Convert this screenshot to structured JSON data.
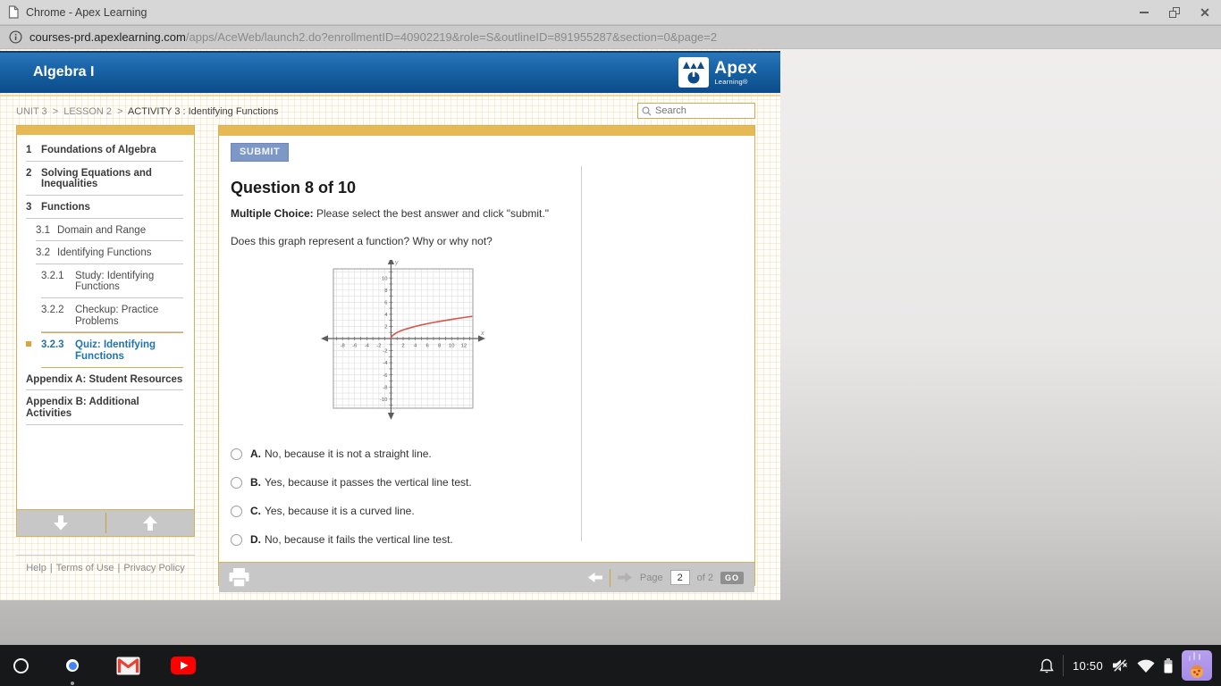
{
  "window": {
    "title": "Chrome - Apex Learning",
    "url_domain": "courses-prd.apexlearning.com",
    "url_path": "/apps/AceWeb/launch2.do?enrollmentID=40902219&role=S&outlineID=891955287&section=0&page=2"
  },
  "header": {
    "course_title": "Algebra I",
    "brand_name": "Apex",
    "brand_sub": "Learning®"
  },
  "breadcrumb": {
    "unit": "UNIT 3",
    "lesson": "LESSON 2",
    "activity": "ACTIVITY 3 : Identifying Functions",
    "separator": ">"
  },
  "search": {
    "placeholder": "Search"
  },
  "sidebar": {
    "items": [
      {
        "num": "1",
        "label": "Foundations of Algebra",
        "level": 1
      },
      {
        "num": "2",
        "label": "Solving Equations and Inequalities",
        "level": 1
      },
      {
        "num": "3",
        "label": "Functions",
        "level": 1
      },
      {
        "num": "3.1",
        "label": "Domain and Range",
        "level": 2
      },
      {
        "num": "3.2",
        "label": "Identifying Functions",
        "level": 2
      },
      {
        "num": "3.2.1",
        "label": "Study: Identifying Functions",
        "level": 3
      },
      {
        "num": "3.2.2",
        "label": "Checkup: Practice Problems",
        "level": 3
      },
      {
        "num": "3.2.3",
        "label": "Quiz: Identifying Functions",
        "level": 3,
        "active": true
      },
      {
        "num": "",
        "label": "Appendix A: Student Resources",
        "level": 1
      },
      {
        "num": "",
        "label": "Appendix B: Additional Activities",
        "level": 1
      }
    ]
  },
  "footer_links": {
    "links": [
      "Help",
      "Terms of Use",
      "Privacy Policy"
    ],
    "separator": "|"
  },
  "question": {
    "submit_label": "SUBMIT",
    "title": "Question 8 of 10",
    "type_label": "Multiple Choice:",
    "instructions": " Please select the best answer and click \"submit.\"",
    "prompt": "Does this graph represent a function? Why or why not?",
    "options": [
      {
        "letter": "A",
        "text": "No, because it is not a straight line."
      },
      {
        "letter": "B",
        "text": "Yes, because it passes the vertical line test."
      },
      {
        "letter": "C",
        "text": "Yes, because it is a curved line."
      },
      {
        "letter": "D",
        "text": "No, because it fails the vertical line test."
      }
    ]
  },
  "chart_data": {
    "type": "line",
    "function": "y = sqrt(x)",
    "title": "",
    "xlabel": "x",
    "ylabel": "y",
    "xlim": [
      -9.5,
      13.5
    ],
    "ylim": [
      -11.5,
      11.5
    ],
    "x_ticks": [
      -8,
      -6,
      -4,
      -2,
      2,
      4,
      6,
      8,
      10,
      12
    ],
    "y_ticks": [
      -10,
      -8,
      -6,
      -4,
      -2,
      2,
      4,
      6,
      8,
      10
    ],
    "grid": true,
    "curve_color": "#d9534a",
    "points": [
      [
        0,
        0
      ],
      [
        0.1,
        0.32
      ],
      [
        0.3,
        0.55
      ],
      [
        0.6,
        0.77
      ],
      [
        1,
        1
      ],
      [
        1.5,
        1.22
      ],
      [
        2,
        1.41
      ],
      [
        2.5,
        1.58
      ],
      [
        3,
        1.73
      ],
      [
        4,
        2
      ],
      [
        5,
        2.24
      ],
      [
        6,
        2.45
      ],
      [
        7,
        2.65
      ],
      [
        8,
        2.83
      ],
      [
        9,
        3
      ],
      [
        10,
        3.16
      ],
      [
        11,
        3.32
      ],
      [
        12,
        3.46
      ],
      [
        13,
        3.61
      ],
      [
        13.4,
        3.66
      ]
    ]
  },
  "pager": {
    "page_label": "Page",
    "current": "2",
    "of_label": "of 2",
    "go_label": "GO"
  },
  "taskbar": {
    "time": "10:50",
    "apps": [
      "launcher",
      "chrome",
      "gmail",
      "youtube"
    ],
    "status_icons": [
      "notification-bell",
      "volume-muted",
      "wifi",
      "battery",
      "pizza-app"
    ]
  },
  "colors": {
    "header_blue": "#155d9f",
    "gold_accent": "#e5ba55",
    "active_link": "#2173ad",
    "submit_button": "#7d98c6",
    "curve_red": "#d9534a"
  }
}
